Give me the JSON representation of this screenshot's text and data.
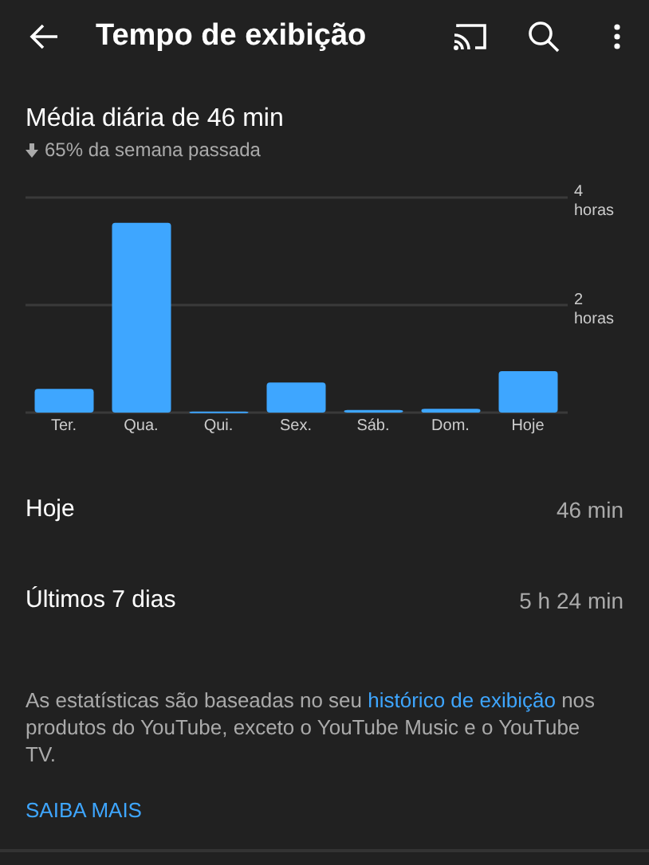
{
  "header": {
    "title": "Tempo de exibição"
  },
  "summary": {
    "title": "Média diária de 46 min",
    "trend": "65% da semana passada"
  },
  "chart_data": {
    "type": "bar",
    "categories": [
      "Ter.",
      "Qua.",
      "Qui.",
      "Sex.",
      "Sáb.",
      "Dom.",
      "Hoje"
    ],
    "series": [
      {
        "color": "#3ea6ff",
        "values": [
          0.44,
          3.53,
          0.02,
          0.56,
          0.05,
          0.07,
          0.77
        ]
      }
    ],
    "ylim": [
      0,
      4
    ],
    "yticks": [
      {
        "value": 2,
        "label": "2 horas"
      },
      {
        "value": 4,
        "label": "4 horas"
      }
    ]
  },
  "stats": [
    {
      "label": "Hoje",
      "value": "46 min"
    },
    {
      "label": "Últimos 7 dias",
      "value": "5 h 24 min"
    }
  ],
  "note": {
    "text": "As estatísticas são baseadas no seu",
    "link": "histórico de exibição",
    "rest": "nos produtos do YouTube, exceto o YouTube Music e o YouTube TV."
  },
  "learn_more": "SAIBA MAIS"
}
